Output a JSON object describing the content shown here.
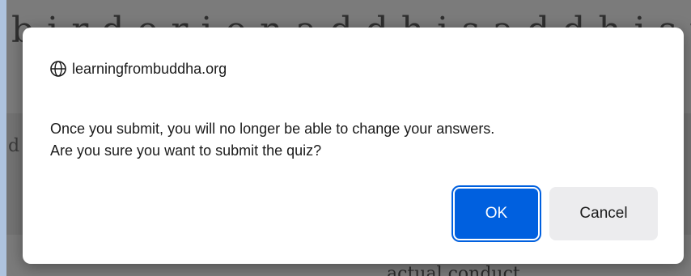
{
  "background": {
    "top_text": "b i r d e r i o n a d d h i s a d d h i s t",
    "side_letter": "d",
    "bottom_text": "actual conduct"
  },
  "dialog": {
    "origin": "learningfrombuddha.org",
    "origin_icon": "globe-icon",
    "message_line1": "Once you submit, you will no longer be able to change your answers.",
    "message_line2": "Are you sure you want to submit the quiz?",
    "ok_label": "OK",
    "cancel_label": "Cancel"
  },
  "colors": {
    "accent": "#0060df",
    "dialog_bg": "#ffffff",
    "cancel_bg": "#ececee",
    "overlay": "#7b7b7b"
  }
}
